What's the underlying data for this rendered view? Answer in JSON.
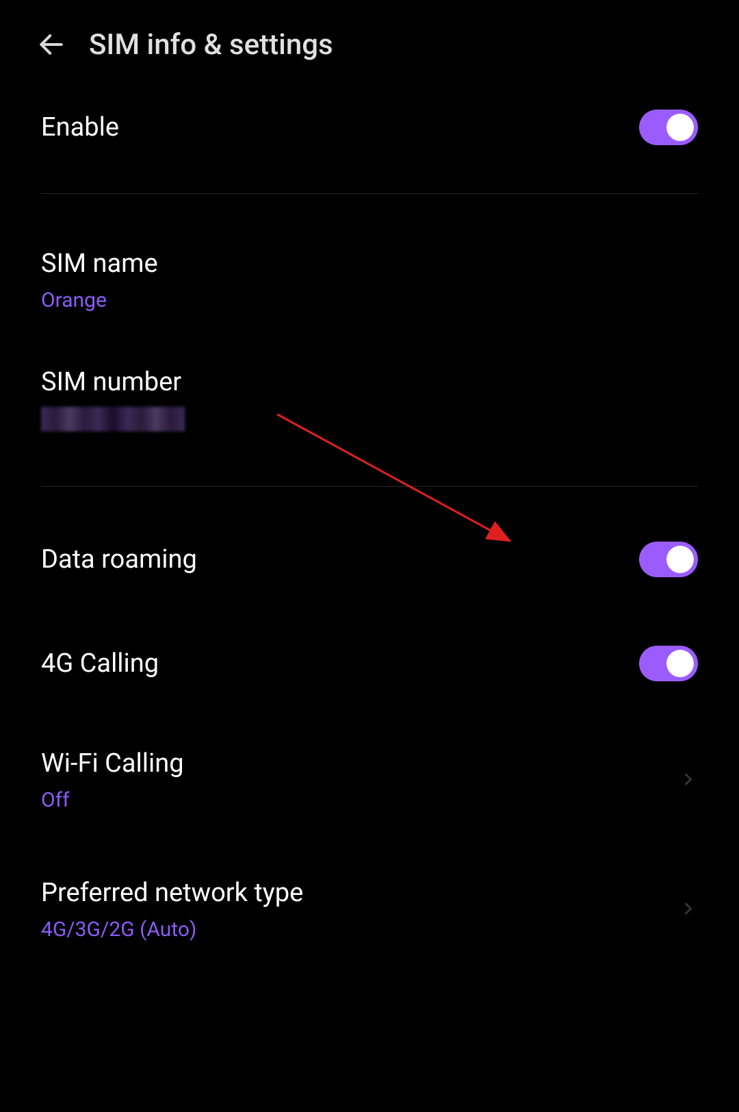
{
  "header": {
    "title": "SIM info & settings"
  },
  "settings": {
    "enable": {
      "label": "Enable",
      "on": true
    },
    "sim_name": {
      "label": "SIM name",
      "value": "Orange"
    },
    "sim_number": {
      "label": "SIM number"
    },
    "data_roaming": {
      "label": "Data roaming",
      "on": true
    },
    "calling_4g": {
      "label": "4G Calling",
      "on": true
    },
    "wifi_calling": {
      "label": "Wi-Fi Calling",
      "value": "Off"
    },
    "preferred_network": {
      "label": "Preferred network type",
      "value": "4G/3G/2G (Auto)"
    }
  },
  "colors": {
    "accent": "#9b5cff",
    "subtext": "#8b5cf6"
  }
}
